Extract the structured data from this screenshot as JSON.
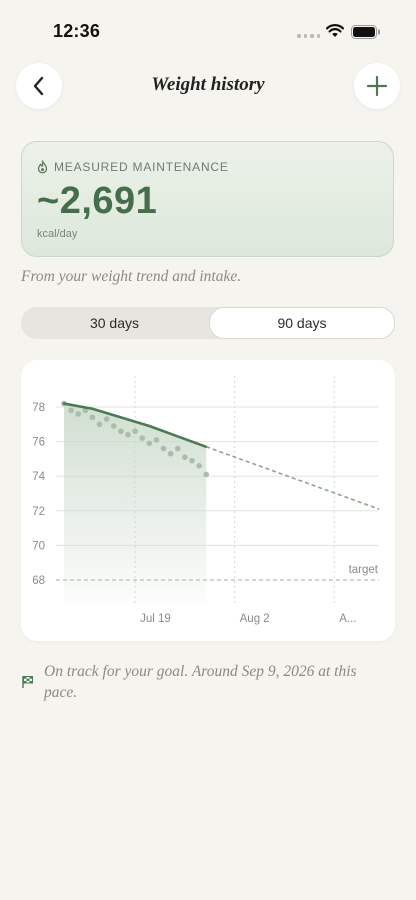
{
  "status_bar": {
    "time": "12:36"
  },
  "header": {
    "title": "Weight history",
    "back_icon": "chevron-left-icon",
    "add_icon": "plus-icon"
  },
  "maintenance": {
    "label": "MEASURED MAINTENANCE",
    "icon": "flame-icon",
    "value": "~2,691",
    "unit": "kcal/day"
  },
  "subtitle": "From your weight trend and intake.",
  "range_toggle": {
    "options": [
      "30 days",
      "90 days"
    ],
    "selected": "90 days"
  },
  "chart_data": {
    "type": "line",
    "y_ticks": [
      "78",
      "76",
      "74",
      "72",
      "70",
      "68"
    ],
    "x_ticks": [
      "Jul 19",
      "Aug 2",
      "A..."
    ],
    "target_label": "target",
    "target_value": 68,
    "ylim": [
      66.5,
      79.5
    ],
    "xlim_days": [
      0,
      44.3
    ],
    "x_tick_days": [
      10,
      24,
      38
    ],
    "series": [
      {
        "kind": "trend",
        "x": [
          0,
          4,
          8,
          12,
          16,
          20
        ],
        "y": [
          78.2,
          77.9,
          77.4,
          76.9,
          76.3,
          75.7
        ]
      },
      {
        "kind": "projection",
        "x": [
          20,
          44.3
        ],
        "y": [
          75.7,
          72.1
        ]
      },
      {
        "kind": "daily",
        "x": [
          0,
          1,
          2,
          3,
          4,
          5,
          6,
          7,
          8,
          9,
          10,
          11,
          12,
          13,
          14,
          15,
          16,
          17,
          18,
          19,
          20
        ],
        "y": [
          78.2,
          77.8,
          77.6,
          77.8,
          77.4,
          77.0,
          77.3,
          76.9,
          76.6,
          76.4,
          76.6,
          76.2,
          75.9,
          76.1,
          75.6,
          75.3,
          75.6,
          75.1,
          74.9,
          74.6,
          74.1
        ]
      }
    ],
    "colors": {
      "trend": "#4c7a53",
      "dots": "#a9bda9",
      "fill": "#c9d8c9",
      "grid": "#e3e3de",
      "projection": "#8aa58c"
    }
  },
  "goal_message": {
    "icon": "flag-icon",
    "text": "On track for your goal. Around Sep 9, 2026 at this pace."
  }
}
